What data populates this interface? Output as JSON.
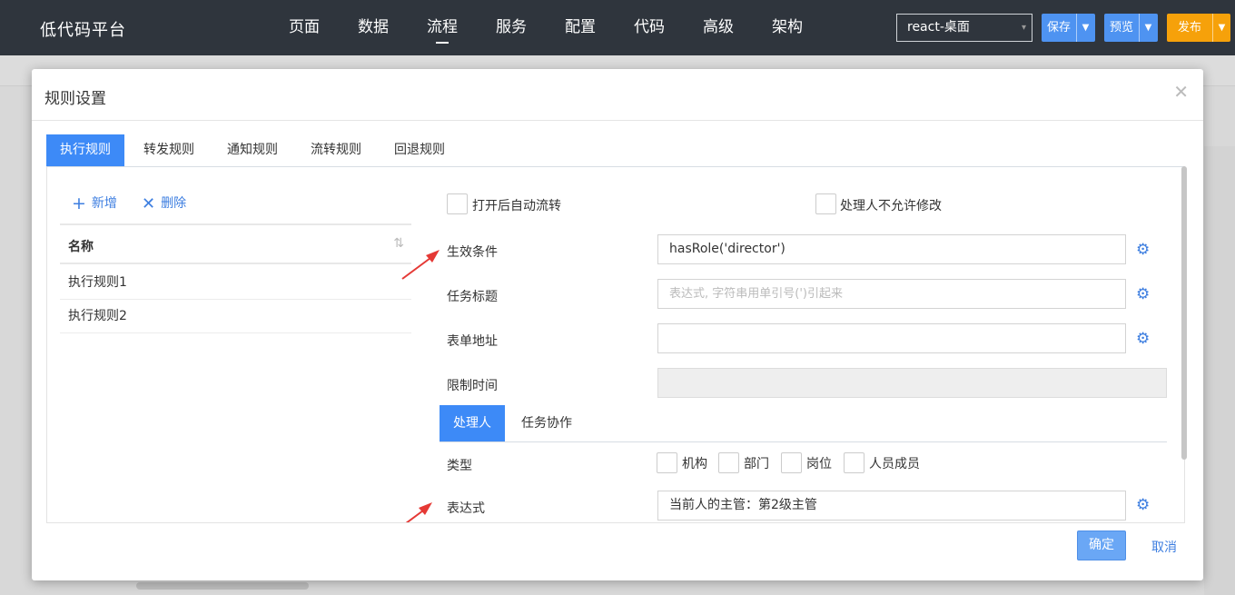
{
  "header": {
    "brand": "低代码平台",
    "nav": [
      "页面",
      "数据",
      "流程",
      "服务",
      "配置",
      "代码",
      "高级",
      "架构"
    ],
    "active_nav": "流程",
    "project_select": "react-桌面",
    "buttons": {
      "save": "保存",
      "preview": "预览",
      "publish": "发布"
    }
  },
  "modal": {
    "title": "规则设置",
    "tabs": [
      "执行规则",
      "转发规则",
      "通知规则",
      "流转规则",
      "回退规则"
    ],
    "active_tab": "执行规则",
    "toolbar": {
      "add": "新增",
      "delete": "删除"
    },
    "list": {
      "column": "名称",
      "rows": [
        "执行规则1",
        "执行规则2"
      ]
    },
    "form": {
      "auto_flow_label": "打开后自动流转",
      "handler_no_modify_label": "处理人不允许修改",
      "condition_label": "生效条件",
      "condition_value": "hasRole('director')",
      "task_title_label": "任务标题",
      "task_title_placeholder": "表达式, 字符串用单引号(')引起来",
      "form_url_label": "表单地址",
      "time_limit_label": "限制时间",
      "sub_tabs": [
        "处理人",
        "任务协作"
      ],
      "type_label": "类型",
      "type_options": [
        "机构",
        "部门",
        "岗位",
        "人员成员"
      ],
      "expression_label": "表达式",
      "expression_value": "当前人的主管：第2级主管"
    },
    "footer": {
      "ok": "确定",
      "cancel": "取消"
    }
  },
  "colors": {
    "accent": "#3d8af7",
    "publish": "#f6a10a",
    "topbar": "#2f353d",
    "arrow": "#e53935"
  }
}
